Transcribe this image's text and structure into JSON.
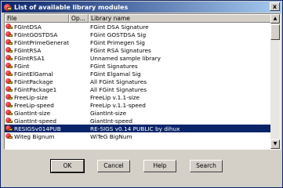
{
  "window": {
    "title": "List of available library modules",
    "close_glyph": "x"
  },
  "list": {
    "columns": [
      "File",
      "Op...",
      "Library name"
    ],
    "rows": [
      {
        "file": "FGIntDSA",
        "op": "",
        "name": "FGint DSA Signature",
        "selected": false
      },
      {
        "file": "FGIntGOSTDSA",
        "op": "",
        "name": "FGint GOSTDSA Sig",
        "selected": false
      },
      {
        "file": "FGIntPrimeGeneration",
        "op": "",
        "name": "FGint Primegen Sig",
        "selected": false
      },
      {
        "file": "FGIntRSA",
        "op": "",
        "name": "FGint RSA Signatures",
        "selected": false
      },
      {
        "file": "FGIntRSA1",
        "op": "",
        "name": "Unnamed sample library",
        "selected": false
      },
      {
        "file": "FGint",
        "op": "",
        "name": "FGint Signatures",
        "selected": false
      },
      {
        "file": "FGintElGamal",
        "op": "",
        "name": "FGint Elgamal Sig",
        "selected": false
      },
      {
        "file": "FGintPackage",
        "op": "",
        "name": "All FGint Signatures",
        "selected": false
      },
      {
        "file": "FGintPackage1",
        "op": "",
        "name": "All FGint Signatures",
        "selected": false
      },
      {
        "file": "FreeLip-size",
        "op": "",
        "name": "FreeLip v.1.1-size",
        "selected": false
      },
      {
        "file": "FreeLip-speed",
        "op": "",
        "name": "FreeLip v.1.1-speed",
        "selected": false
      },
      {
        "file": "GiantInt-size",
        "op": "",
        "name": "GiantInt-size",
        "selected": false
      },
      {
        "file": "GiantInt-speed",
        "op": "",
        "name": "GiantInt-speed",
        "selected": false
      },
      {
        "file": "RESIGSv014PUB",
        "op": "",
        "name": "RE-SIGS v0.14 PUBLIC by dihux",
        "selected": true
      },
      {
        "file": "Witeg Bignum",
        "op": "",
        "name": "WiTeG BigNum",
        "selected": false
      }
    ]
  },
  "scrollbar": {
    "up_glyph": "▲",
    "down_glyph": "▼"
  },
  "buttons": {
    "ok": "OK",
    "cancel": "Cancel",
    "help": "Help",
    "search": "Search"
  }
}
